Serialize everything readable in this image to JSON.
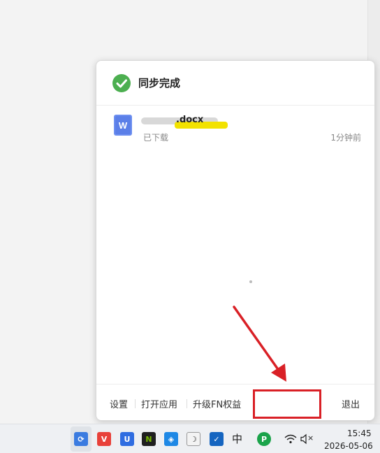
{
  "panel": {
    "title": "同步完成",
    "status_icon": "check-circle-icon",
    "accent_color": "#4caf50"
  },
  "file": {
    "name_visible": ".docx",
    "icon": "word-document-icon",
    "icon_letter": "W",
    "status": "已下载",
    "time": "1分钟前"
  },
  "footer": {
    "settings": "设置",
    "open_app": "打开应用",
    "upgrade": "升级FN权益",
    "exit": "退出"
  },
  "annotation": {
    "color": "#d92026"
  },
  "taskbar": {
    "ime": "中",
    "volume_state": "×",
    "time": "15:45",
    "date": "2026-05-06"
  }
}
